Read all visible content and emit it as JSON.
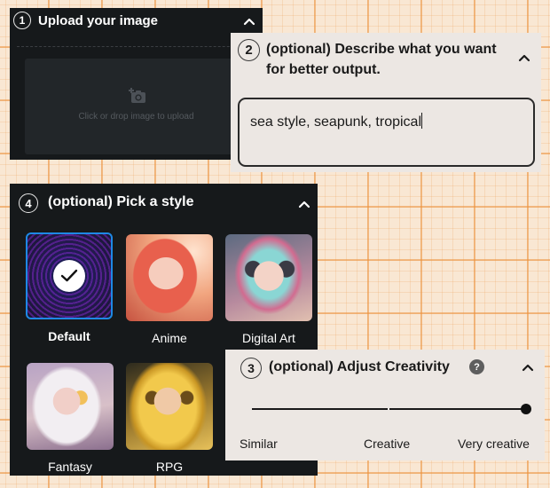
{
  "upload": {
    "step": "1",
    "title": "Upload your image",
    "dropzone_text": "Click or drop image to upload"
  },
  "describe": {
    "step": "2",
    "title": "(optional) Describe what you want for better output.",
    "value": "sea style, seapunk, tropical"
  },
  "style": {
    "step": "4",
    "title": "(optional) Pick a style",
    "items": [
      {
        "label": "Default",
        "selected": true
      },
      {
        "label": "Anime",
        "selected": false
      },
      {
        "label": "Digital Art",
        "selected": false
      },
      {
        "label": "Fantasy",
        "selected": false
      },
      {
        "label": "RPG",
        "selected": false
      }
    ]
  },
  "creativity": {
    "step": "3",
    "title": "(optional) Adjust Creativity",
    "help": "?",
    "labels": [
      "Similar",
      "Creative",
      "Very creative"
    ],
    "level": 1.0
  },
  "colors": {
    "dark_panel": "#16191b",
    "light_panel": "#ece7e3",
    "selected_border": "#1e88e5"
  }
}
